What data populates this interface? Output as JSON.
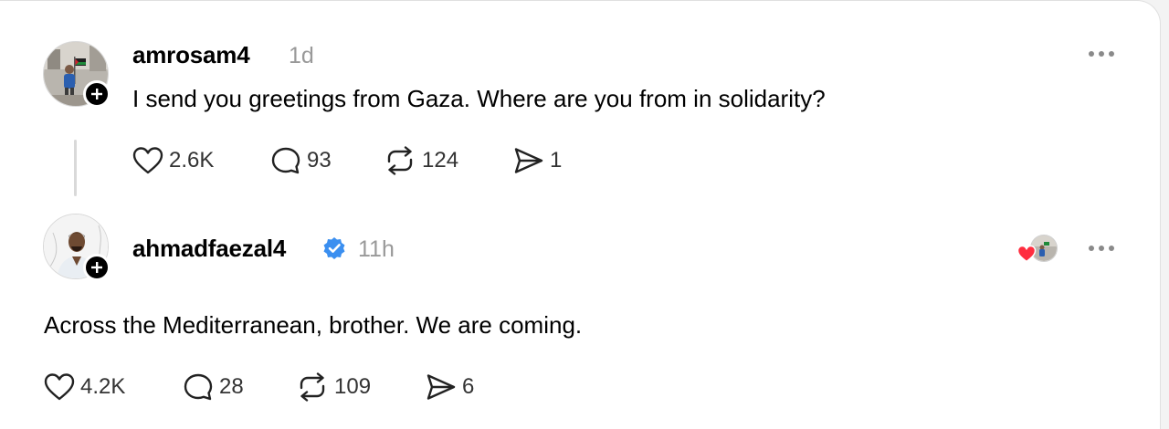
{
  "posts": [
    {
      "username": "amrosam4",
      "time": "1d",
      "text": "I send you greetings from Gaza. Where are you from in solidarity?",
      "likes": "2.6K",
      "comments": "93",
      "reposts": "124",
      "shares": "1"
    },
    {
      "username": "ahmadfaezal4",
      "verified": true,
      "time": "11h",
      "text": "Across the Mediterranean, brother. We are coming.",
      "likes": "4.2K",
      "comments": "28",
      "reposts": "109",
      "shares": "6"
    }
  ],
  "colors": {
    "verified": "#3b8ff0",
    "heart": "#ff2d3f",
    "muted": "#999999"
  }
}
